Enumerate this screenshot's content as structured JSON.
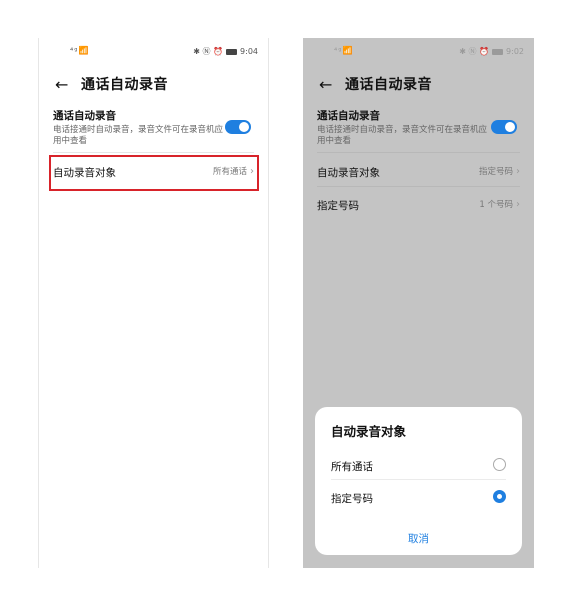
{
  "left": {
    "status": {
      "signal": "⁴⁰◢ ◎",
      "icons": "✱ Ⓝ ⏰",
      "time": "9:04"
    },
    "header": {
      "title": "通话自动录音"
    },
    "auto_record": {
      "label": "通话自动录音",
      "description": "电话接通时自动录音，录音文件可在录音机应用中查看",
      "enabled": true
    },
    "target": {
      "label": "自动录音对象",
      "value": "所有通话"
    }
  },
  "right": {
    "status": {
      "signal": "⁴⁰◢ ◎",
      "icons": "✱ Ⓝ ⏰",
      "time": "9:02"
    },
    "header": {
      "title": "通话自动录音"
    },
    "auto_record": {
      "label": "通话自动录音",
      "description": "电话接通时自动录音，录音文件可在录音机应用中查看",
      "enabled": true
    },
    "target": {
      "label": "自动录音对象",
      "value": "指定号码"
    },
    "numbers": {
      "label": "指定号码",
      "value": "1 个号码"
    },
    "sheet": {
      "title": "自动录音对象",
      "options": [
        {
          "label": "所有通话",
          "selected": false
        },
        {
          "label": "指定号码",
          "selected": true
        }
      ],
      "cancel": "取消"
    }
  },
  "colors": {
    "accent": "#1f7fe0",
    "highlight": "#d8232a",
    "dim": "#c4c4c4"
  },
  "icons": {
    "back": "arrow-left-icon",
    "chevron": "chevron-right-icon"
  }
}
